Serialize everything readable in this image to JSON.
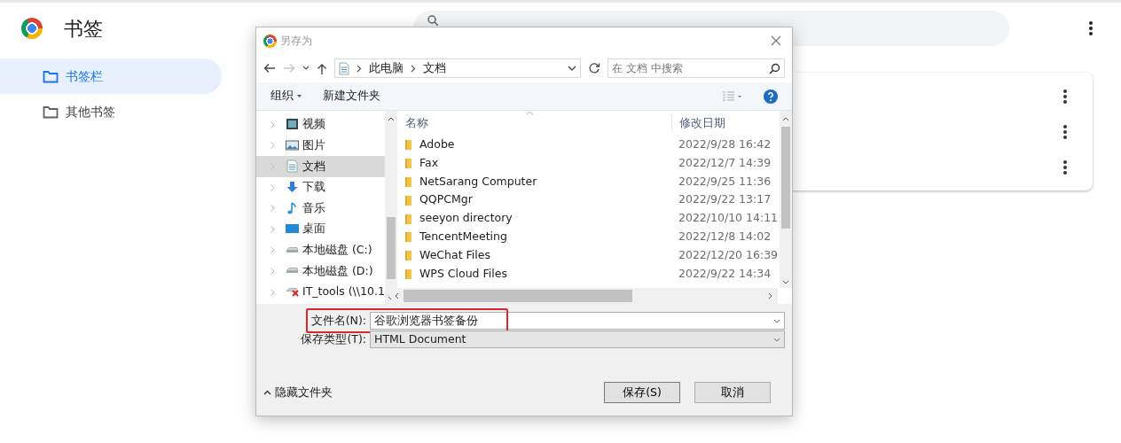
{
  "page": {
    "title": "书签",
    "sidebar": [
      {
        "label": "书签栏",
        "selected": true
      },
      {
        "label": "其他书签",
        "selected": false
      }
    ]
  },
  "dialog": {
    "title": "另存为",
    "forward_disabled": true,
    "breadcrumb": [
      "此电脑",
      "文档"
    ],
    "search": {
      "placeholder": "在 文档 中搜索"
    },
    "toolbar": [
      "组织",
      "新建文件夹"
    ],
    "tree": [
      {
        "label": "视频",
        "kind": "video",
        "selected": false
      },
      {
        "label": "图片",
        "kind": "picture",
        "selected": false
      },
      {
        "label": "文档",
        "kind": "document",
        "selected": true
      },
      {
        "label": "下载",
        "kind": "download",
        "selected": false
      },
      {
        "label": "音乐",
        "kind": "music",
        "selected": false
      },
      {
        "label": "桌面",
        "kind": "desktop",
        "selected": false
      },
      {
        "label": "本地磁盘 (C:)",
        "kind": "drive",
        "selected": false
      },
      {
        "label": "本地磁盘 (D:)",
        "kind": "drive",
        "selected": false
      },
      {
        "label": "IT_tools (\\\\10.1",
        "kind": "network",
        "selected": false
      }
    ],
    "columns": [
      "名称",
      "修改日期"
    ],
    "files": [
      {
        "name": "Adobe",
        "date": "2022/9/28 16:42"
      },
      {
        "name": "Fax",
        "date": "2022/12/7 14:39"
      },
      {
        "name": "NetSarang Computer",
        "date": "2022/9/25 11:36"
      },
      {
        "name": "QQPCMgr",
        "date": "2022/9/22 13:17"
      },
      {
        "name": "seeyon directory",
        "date": "2022/10/10 14:11"
      },
      {
        "name": "TencentMeeting",
        "date": "2022/12/8 14:02"
      },
      {
        "name": "WeChat Files",
        "date": "2022/12/20 16:39"
      },
      {
        "name": "WPS Cloud Files",
        "date": "2022/9/22 14:34"
      }
    ],
    "filename": {
      "label": "文件名(N):",
      "value": "谷歌浏览器书签备份",
      "highlighted": true
    },
    "filetype": {
      "label": "保存类型(T):",
      "value": "HTML Document"
    },
    "hide_folders": "隐藏文件夹",
    "buttons": [
      "保存(S)",
      "取消"
    ]
  }
}
